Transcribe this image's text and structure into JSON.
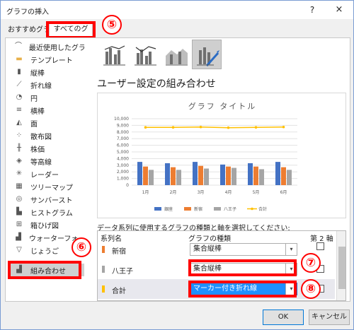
{
  "dialog": {
    "title": "グラフの挿入",
    "help": "?",
    "close": "×"
  },
  "tabs": {
    "recommended": "おすすめグラフ",
    "all": "すべてのグラフ"
  },
  "annotations": [
    "⑤",
    "⑥",
    "⑦",
    "⑧"
  ],
  "sidebar": {
    "items": [
      {
        "label": "最近使用したグラフ",
        "icon": "recent-icon"
      },
      {
        "label": "テンプレート",
        "icon": "folder-icon"
      },
      {
        "label": "縦棒",
        "icon": "column-chart-icon"
      },
      {
        "label": "折れ線",
        "icon": "line-chart-icon"
      },
      {
        "label": "円",
        "icon": "pie-chart-icon"
      },
      {
        "label": "横棒",
        "icon": "bar-chart-icon"
      },
      {
        "label": "面",
        "icon": "area-chart-icon"
      },
      {
        "label": "散布図",
        "icon": "scatter-chart-icon"
      },
      {
        "label": "株価",
        "icon": "stock-chart-icon"
      },
      {
        "label": "等高線",
        "icon": "surface-chart-icon"
      },
      {
        "label": "レーダー",
        "icon": "radar-chart-icon"
      },
      {
        "label": "ツリーマップ",
        "icon": "treemap-icon"
      },
      {
        "label": "サンバースト",
        "icon": "sunburst-icon"
      },
      {
        "label": "ヒストグラム",
        "icon": "histogram-icon"
      },
      {
        "label": "箱ひげ図",
        "icon": "box-whisker-icon"
      },
      {
        "label": "ウォーターフォール",
        "icon": "waterfall-icon"
      },
      {
        "label": "じょうご",
        "icon": "funnel-icon"
      },
      {
        "label": "組み合わせ",
        "icon": "combo-chart-icon"
      }
    ]
  },
  "main": {
    "section_title": "ユーザー設定の組み合わせ",
    "series_caption": "データ系列に使用するグラフの種類と軸を選択してください:",
    "columns": {
      "name": "系列名",
      "type": "グラフの種類",
      "secondary": "第 2 軸"
    },
    "rows": [
      {
        "name": "新宿",
        "type": "集合縦棒",
        "color": "#ed7d31",
        "secondary": false
      },
      {
        "name": "八王子",
        "type": "集合縦棒",
        "color": "#a5a5a5",
        "secondary": false
      },
      {
        "name": "合計",
        "type": "マーカー付き折れ線",
        "color": "#ffc000",
        "secondary": false
      }
    ]
  },
  "buttons": {
    "ok": "OK",
    "cancel": "キャンセル"
  },
  "chart_data": {
    "type": "bar",
    "title": "グラフ タイトル",
    "categories": [
      "1月",
      "2月",
      "3月",
      "4月",
      "5月",
      "6月"
    ],
    "ylim": [
      0,
      10000
    ],
    "yticks": [
      "0",
      "1,000",
      "2,000",
      "3,000",
      "4,000",
      "5,000",
      "6,000",
      "7,000",
      "8,000",
      "9,000",
      "10,000"
    ],
    "grid": true,
    "legend": "bottom",
    "series": [
      {
        "name": "銀座",
        "kind": "bar",
        "color": "#4472c4",
        "values": [
          3500,
          3300,
          3500,
          3100,
          3300,
          3500
        ]
      },
      {
        "name": "新宿",
        "kind": "bar",
        "color": "#ed7d31",
        "values": [
          2800,
          2700,
          2900,
          2800,
          2800,
          2700
        ]
      },
      {
        "name": "八王子",
        "kind": "bar",
        "color": "#a5a5a5",
        "values": [
          2300,
          2300,
          2500,
          2600,
          2400,
          2300
        ]
      },
      {
        "name": "合計",
        "kind": "line",
        "color": "#ffc000",
        "values": [
          8700,
          8700,
          8750,
          8650,
          8700,
          8750
        ]
      }
    ]
  }
}
